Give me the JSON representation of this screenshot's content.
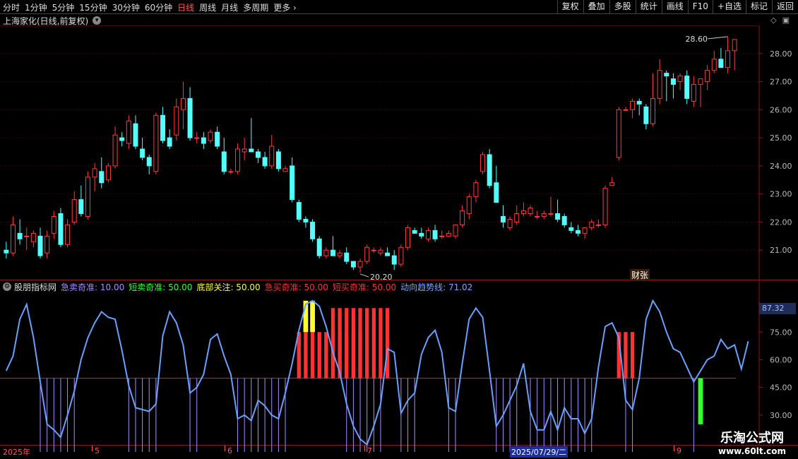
{
  "toolbar": {
    "periods": [
      "分时",
      "1分钟",
      "5分钟",
      "15分钟",
      "30分钟",
      "60分钟",
      "日线",
      "周线",
      "月线",
      "多周期",
      "更多"
    ],
    "active_period": "日线",
    "tools": [
      "复权",
      "叠加",
      "多股",
      "统计",
      "画线",
      "F10",
      "+自选",
      "标记",
      "返回"
    ]
  },
  "title": "上海家化(日线,前复权)",
  "main_chart": {
    "high_label": "28.60",
    "low_label": "20.20",
    "event_tag": "财张",
    "yaxis_ticks": [
      "28.00",
      "27.00",
      "26.00",
      "25.00",
      "24.00",
      "23.00",
      "22.00",
      "21.00"
    ]
  },
  "indicator": {
    "name": "股朋指标网",
    "items": [
      {
        "label": "急卖奇准: 10.00",
        "color": "#a98cff"
      },
      {
        "label": "短卖奇准: 50.00",
        "color": "#33ff33"
      },
      {
        "label": "底部关注: 50.00",
        "color": "#ffff33"
      },
      {
        "label": "急买奇准: 50.00",
        "color": "#ff3333"
      },
      {
        "label": "短买奇准: 50.00",
        "color": "#ff3333"
      },
      {
        "label": "动向趋势线: 71.02",
        "color": "#7aa6ff"
      }
    ],
    "current_value": "87.32",
    "yaxis_ticks": [
      "75.00",
      "60.00",
      "45.00",
      "30.00"
    ]
  },
  "date_bar": {
    "labels": [
      "2025年",
      "5",
      "6",
      "7",
      "2025/07/29/二",
      "9"
    ]
  },
  "watermark": {
    "line1": "乐淘公式网",
    "line2": "www.60lt.com"
  },
  "chart_data": [
    {
      "type": "candlestick",
      "title": "上海家化(日线,前复权)",
      "ylim": [
        20.0,
        28.9
      ],
      "yticks": [
        21,
        22,
        23,
        24,
        25,
        26,
        27,
        28
      ],
      "annotations": [
        {
          "text": "28.60",
          "value": 28.6
        },
        {
          "text": "20.20",
          "value": 20.2
        }
      ],
      "ohlc": [
        [
          21.0,
          21.3,
          20.7,
          20.9
        ],
        [
          20.9,
          22.2,
          20.8,
          21.9
        ],
        [
          21.6,
          22.1,
          21.2,
          21.4
        ],
        [
          21.5,
          21.8,
          21.0,
          21.5
        ],
        [
          21.3,
          21.7,
          21.1,
          21.6
        ],
        [
          21.5,
          21.8,
          20.7,
          20.8
        ],
        [
          20.9,
          21.7,
          20.7,
          21.5
        ],
        [
          21.6,
          22.4,
          21.4,
          22.2
        ],
        [
          22.3,
          22.5,
          21.1,
          21.2
        ],
        [
          21.2,
          22.1,
          21.1,
          21.9
        ],
        [
          22.0,
          23.1,
          21.9,
          22.8
        ],
        [
          22.8,
          23.3,
          22.2,
          22.3
        ],
        [
          22.2,
          23.8,
          22.1,
          23.6
        ],
        [
          23.6,
          24.1,
          23.1,
          23.9
        ],
        [
          23.8,
          24.3,
          23.2,
          23.4
        ],
        [
          23.5,
          24.1,
          23.4,
          24.0
        ],
        [
          24.0,
          25.4,
          23.9,
          25.1
        ],
        [
          25.0,
          25.2,
          24.7,
          24.9
        ],
        [
          24.8,
          25.8,
          24.6,
          25.6
        ],
        [
          25.5,
          25.8,
          24.6,
          24.7
        ],
        [
          24.6,
          25.0,
          24.2,
          24.3
        ],
        [
          24.3,
          24.4,
          23.7,
          24.0
        ],
        [
          23.8,
          25.9,
          23.7,
          25.8
        ],
        [
          25.8,
          26.1,
          24.8,
          24.9
        ],
        [
          25.0,
          25.3,
          24.6,
          24.7
        ],
        [
          25.1,
          26.4,
          24.9,
          26.1
        ],
        [
          26.0,
          27.0,
          25.3,
          26.4
        ],
        [
          26.4,
          26.8,
          24.9,
          25.0
        ],
        [
          25.0,
          25.2,
          24.8,
          25.0
        ],
        [
          25.0,
          25.2,
          24.6,
          24.8
        ],
        [
          24.9,
          25.3,
          24.8,
          25.2
        ],
        [
          25.2,
          25.4,
          24.6,
          24.7
        ],
        [
          24.5,
          25.0,
          23.7,
          23.8
        ],
        [
          23.8,
          23.9,
          23.7,
          23.8
        ],
        [
          23.8,
          24.8,
          23.7,
          24.6
        ],
        [
          24.5,
          25.0,
          24.2,
          24.6
        ],
        [
          24.6,
          25.7,
          24.5,
          24.5
        ],
        [
          24.5,
          24.6,
          24.1,
          24.3
        ],
        [
          24.3,
          24.5,
          23.9,
          24.0
        ],
        [
          24.0,
          25.1,
          23.9,
          24.7
        ],
        [
          24.5,
          24.6,
          23.8,
          23.9
        ],
        [
          23.8,
          24.0,
          23.8,
          23.9
        ],
        [
          24.0,
          24.3,
          22.7,
          22.8
        ],
        [
          22.7,
          22.8,
          22.0,
          22.1
        ],
        [
          22.1,
          22.2,
          21.8,
          22.0
        ],
        [
          22.0,
          22.1,
          21.3,
          21.4
        ],
        [
          21.4,
          21.5,
          20.7,
          20.8
        ],
        [
          20.8,
          21.1,
          20.7,
          21.0
        ],
        [
          21.0,
          21.5,
          20.8,
          20.8
        ],
        [
          20.8,
          21.0,
          20.7,
          20.9
        ],
        [
          20.9,
          21.1,
          20.5,
          20.6
        ],
        [
          20.6,
          20.6,
          20.3,
          20.4
        ],
        [
          20.4,
          20.7,
          20.2,
          20.6
        ],
        [
          20.6,
          21.2,
          20.5,
          21.1
        ],
        [
          21.0,
          21.1,
          20.9,
          21.0
        ],
        [
          20.9,
          21.1,
          20.8,
          21.0
        ],
        [
          20.9,
          21.1,
          20.8,
          20.8
        ],
        [
          20.8,
          21.0,
          20.3,
          20.5
        ],
        [
          20.5,
          21.2,
          20.4,
          21.1
        ],
        [
          21.1,
          21.9,
          21.0,
          21.8
        ],
        [
          21.7,
          21.8,
          21.6,
          21.6
        ],
        [
          21.6,
          21.8,
          21.4,
          21.5
        ],
        [
          21.4,
          21.8,
          21.3,
          21.7
        ],
        [
          21.7,
          21.9,
          21.3,
          21.4
        ],
        [
          21.5,
          21.7,
          21.4,
          21.5
        ],
        [
          21.5,
          21.7,
          21.5,
          21.6
        ],
        [
          21.5,
          21.9,
          21.4,
          21.9
        ],
        [
          21.9,
          22.6,
          21.8,
          22.4
        ],
        [
          22.3,
          23.0,
          22.1,
          22.9
        ],
        [
          22.9,
          23.5,
          22.7,
          23.4
        ],
        [
          23.8,
          24.5,
          23.7,
          24.4
        ],
        [
          24.4,
          24.6,
          23.2,
          23.3
        ],
        [
          23.4,
          24.0,
          22.7,
          22.7
        ],
        [
          22.2,
          22.6,
          21.8,
          22.0
        ],
        [
          21.8,
          22.2,
          21.7,
          22.1
        ],
        [
          22.0,
          22.6,
          21.9,
          22.3
        ],
        [
          22.3,
          22.7,
          22.2,
          22.4
        ],
        [
          22.3,
          22.6,
          22.2,
          22.5
        ],
        [
          22.2,
          22.4,
          22.1,
          22.2
        ],
        [
          22.2,
          22.4,
          22.1,
          22.3
        ],
        [
          22.3,
          22.9,
          22.2,
          22.3
        ],
        [
          22.3,
          22.8,
          22.0,
          22.1
        ],
        [
          22.2,
          22.3,
          21.8,
          21.9
        ],
        [
          21.8,
          22.0,
          21.6,
          21.7
        ],
        [
          21.7,
          21.9,
          21.5,
          21.6
        ],
        [
          21.6,
          21.8,
          21.4,
          21.8
        ],
        [
          21.8,
          22.1,
          21.7,
          22.0
        ],
        [
          21.9,
          22.1,
          21.8,
          21.9
        ],
        [
          21.9,
          23.3,
          21.8,
          23.2
        ],
        [
          23.3,
          23.6,
          23.3,
          23.4
        ],
        [
          24.3,
          26.1,
          24.2,
          26.0
        ],
        [
          26.0,
          26.1,
          26.0,
          26.0
        ],
        [
          26.0,
          26.4,
          25.7,
          26.3
        ],
        [
          26.3,
          26.4,
          25.8,
          26.2
        ],
        [
          26.1,
          26.2,
          25.3,
          25.5
        ],
        [
          25.5,
          27.3,
          25.4,
          26.4
        ],
        [
          26.4,
          27.8,
          26.2,
          27.4
        ],
        [
          27.3,
          27.4,
          26.3,
          27.2
        ],
        [
          27.1,
          27.3,
          26.4,
          26.9
        ],
        [
          27.0,
          27.3,
          26.7,
          27.2
        ],
        [
          27.2,
          27.4,
          26.2,
          26.4
        ],
        [
          26.3,
          27.2,
          26.1,
          26.9
        ],
        [
          26.9,
          27.1,
          26.1,
          27.1
        ],
        [
          27.0,
          27.6,
          26.7,
          27.4
        ],
        [
          27.4,
          28.1,
          27.3,
          27.8
        ],
        [
          27.8,
          28.2,
          27.6,
          27.5
        ],
        [
          27.5,
          28.6,
          27.3,
          28.1
        ],
        [
          28.1,
          28.5,
          27.4,
          28.5
        ]
      ]
    },
    {
      "type": "line",
      "title": "股朋指标网",
      "ylim": [
        15,
        95
      ],
      "yticks": [
        30,
        45,
        60,
        75
      ],
      "series": [
        {
          "name": "动向趋势线",
          "color": "#6aa0ff",
          "values": [
            54,
            62,
            82,
            90,
            72,
            48,
            25,
            22,
            18,
            30,
            43,
            60,
            72,
            80,
            86,
            83,
            82,
            65,
            46,
            34,
            33,
            32,
            36,
            73,
            86,
            80,
            68,
            42,
            45,
            52,
            71,
            74,
            62,
            52,
            28,
            30,
            27,
            38,
            35,
            30,
            28,
            42,
            58,
            76,
            90,
            92,
            89,
            78,
            64,
            53,
            36,
            24,
            17,
            14,
            24,
            36,
            66,
            64,
            31,
            38,
            42,
            63,
            72,
            76,
            64,
            34,
            32,
            58,
            82,
            88,
            83,
            54,
            24,
            30,
            38,
            46,
            58,
            32,
            22,
            22,
            32,
            22,
            34,
            28,
            28,
            20,
            28,
            56,
            78,
            80,
            72,
            38,
            33,
            50,
            82,
            92,
            86,
            75,
            66,
            64,
            56,
            48,
            54,
            60,
            62,
            71,
            66,
            68,
            55,
            70
          ]
        },
        {
          "name": "急卖奇准",
          "color": "#a98cff"
        },
        {
          "name": "短卖奇准",
          "color": "#33ff33"
        },
        {
          "name": "底部关注",
          "color": "#ffff33"
        },
        {
          "name": "急买奇准",
          "color": "#ff3333"
        },
        {
          "name": "短买奇准",
          "color": "#ff3333"
        }
      ]
    }
  ]
}
